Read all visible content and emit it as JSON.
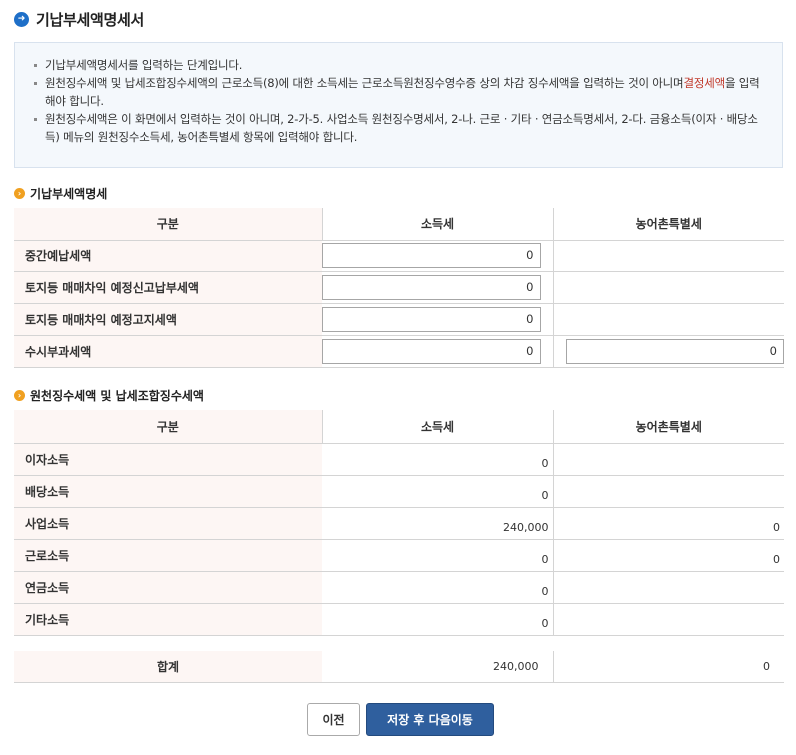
{
  "page": {
    "title": "기납부세액명세서"
  },
  "info": {
    "items": [
      {
        "text": "기납부세액명세서를 입력하는 단계입니다."
      },
      {
        "text_a": "원천징수세액 및 납세조합징수세액의 근로소득(8)에 대한 소득세는 근로소득원천징수영수증 상의 차감 징수세액을 입력하는 것이 아니며",
        "highlight": "결정세액",
        "text_b": "을 입력해야 합니다."
      },
      {
        "text": "원천징수세액은 이 화면에서 입력하는 것이 아니며, 2-가-5. 사업소득 원천징수명세서, 2-나. 근로 · 기타 · 연금소득명세서, 2-다. 금융소득(이자 · 배당소득) 메뉴의 원천징수소득세, 농어촌특별세 항목에 입력해야 합니다."
      }
    ]
  },
  "section1": {
    "title": "기납부세액명세",
    "headers": [
      "구분",
      "소득세",
      "농어촌특별세"
    ],
    "rows": [
      {
        "label": "중간예납세액",
        "income_tax": "0",
        "rural_tax": null
      },
      {
        "label": "토지등 매매차익 예정신고납부세액",
        "income_tax": "0",
        "rural_tax": null
      },
      {
        "label": "토지등 매매차익 예정고지세액",
        "income_tax": "0",
        "rural_tax": null
      },
      {
        "label": "수시부과세액",
        "income_tax": "0",
        "rural_tax": "0"
      }
    ]
  },
  "section2": {
    "title": "원천징수세액 및 납세조합징수세액",
    "headers": [
      "구분",
      "소득세",
      "농어촌특별세"
    ],
    "rows": [
      {
        "label": "이자소득",
        "income_tax": "0",
        "rural_tax": ""
      },
      {
        "label": "배당소득",
        "income_tax": "0",
        "rural_tax": ""
      },
      {
        "label": "사업소득",
        "income_tax": "240,000",
        "rural_tax": "0"
      },
      {
        "label": "근로소득",
        "income_tax": "0",
        "rural_tax": "0"
      },
      {
        "label": "연금소득",
        "income_tax": "0",
        "rural_tax": ""
      },
      {
        "label": "기타소득",
        "income_tax": "0",
        "rural_tax": ""
      }
    ],
    "total": {
      "label": "합계",
      "income_tax": "240,000",
      "rural_tax": "0"
    }
  },
  "buttons": {
    "prev": "이전",
    "next": "저장 후 다음이동"
  },
  "icons": {
    "title": "arrow-right-circle-icon",
    "section": "chevron-right-circle-icon"
  },
  "colors": {
    "accent": "#2f5f9e",
    "section_icon": "#f0a020",
    "highlight": "#c0392b"
  }
}
